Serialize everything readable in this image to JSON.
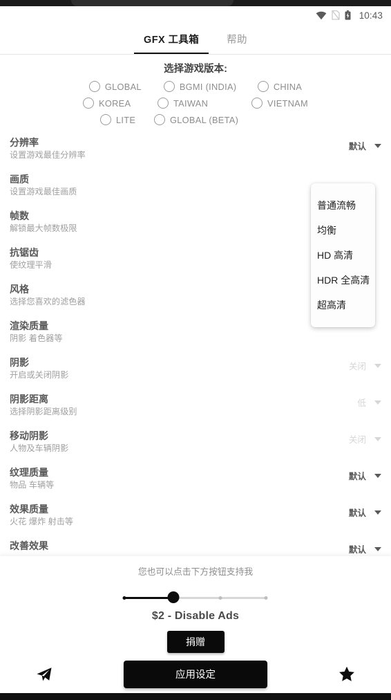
{
  "statusbar": {
    "time": "10:43",
    "icons": [
      "wifi-icon",
      "no-sim-icon",
      "battery-charging-icon"
    ]
  },
  "tabs": [
    {
      "label": "GFX 工具箱",
      "active": true
    },
    {
      "label": "帮助",
      "active": false
    }
  ],
  "version_selector": {
    "title": "选择游戏版本:",
    "rows": [
      [
        "GLOBAL",
        "BGMI (INDIA)",
        "CHINA"
      ],
      [
        "KOREA",
        "TAIWAN",
        "VIETNAM"
      ],
      [
        "LITE",
        "GLOBAL (BETA)"
      ]
    ]
  },
  "settings": [
    {
      "title": "分辨率",
      "sub": "设置游戏最佳分辨率",
      "value": "默认",
      "dim": false
    },
    {
      "title": "画质",
      "sub": "设置游戏最佳画质",
      "value": "",
      "dim": false
    },
    {
      "title": "帧数",
      "sub": "解锁最大帧数极限",
      "value": "",
      "dim": false
    },
    {
      "title": "抗锯齿",
      "sub": "使纹理平滑",
      "value": "",
      "dim": false
    },
    {
      "title": "风格",
      "sub": "选择您喜欢的滤色器",
      "value": "",
      "dim": false
    },
    {
      "title": "渲染质量",
      "sub": "阴影 着色器等",
      "value": "",
      "dim": false
    },
    {
      "title": "阴影",
      "sub": "开启或关闭阴影",
      "value": "关闭",
      "dim": true
    },
    {
      "title": "阴影距离",
      "sub": "选择阴影距离级别",
      "value": "低",
      "dim": true
    },
    {
      "title": "移动阴影",
      "sub": "人物及车辆阴影",
      "value": "关闭",
      "dim": true
    },
    {
      "title": "纹理质量",
      "sub": "物品 车辆等",
      "value": "默认",
      "dim": false
    },
    {
      "title": "效果质量",
      "sub": "火花 爆炸 射击等",
      "value": "默认",
      "dim": false
    },
    {
      "title": "改善效果",
      "sub": "",
      "value": "默认",
      "dim": false
    }
  ],
  "dropdown": {
    "open": true,
    "items": [
      "普通流畅",
      "均衡",
      "HD 高清",
      "HDR 全高清",
      "超高清"
    ]
  },
  "bottom": {
    "support_text": "您也可以点击下方按钮支持我",
    "slider": {
      "ticks": 4,
      "selected_index": 1,
      "fill_percent": 35
    },
    "price_label": "$2 - Disable Ads",
    "donate_label": "捐赠",
    "apply_label": "应用设定",
    "left_icon": "telegram-send-icon",
    "right_icon": "star-icon"
  }
}
